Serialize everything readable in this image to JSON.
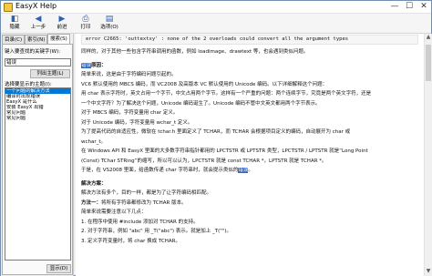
{
  "window": {
    "title": "EasyX Help",
    "minimize": "—",
    "maximize": "☐",
    "close": "✕"
  },
  "toolbar": {
    "buttons": [
      {
        "label": "隐藏",
        "icon": "hide-icon",
        "glyph": "◧"
      },
      {
        "label": "上一步",
        "icon": "back-icon",
        "glyph": "◀"
      },
      {
        "label": "前进",
        "icon": "forward-icon",
        "glyph": "▶"
      },
      {
        "label": "打印",
        "icon": "print-icon",
        "glyph": "⎙"
      },
      {
        "label": "选项(O)",
        "icon": "options-icon",
        "glyph": "▤"
      }
    ]
  },
  "sidebar": {
    "tabs": [
      "目录(C)",
      "索引(N)",
      "搜索(S)"
    ],
    "active_tab": "搜索(S)",
    "keyword_label": "键入要查找的关键字(W):",
    "keyword_value": "错误",
    "list_button": "列出主题(L)",
    "topics_label": "选择要显示的主题(I):",
    "topics": [
      "一个问题的解决方法",
      "编译时出现错误",
      "EasyX 是什么",
      "安装 EasyX 出错",
      "常见问题",
      "常见问题"
    ],
    "selected_topic": 0,
    "show_button": "显示(D)"
  },
  "content": {
    "lines": [
      {
        "cls": "code",
        "text": "error C2665: 'outtextxy' : none of the 2 overloads could convert all the argument types"
      },
      {
        "text": "同样的，对于其他一些包含字符串调用的函数，例如 loadimage、drawtext 等，也会遇到类似问题。"
      },
      {
        "cls": "gap",
        "text": ""
      },
      {
        "hl": "错误",
        "text": "原因："
      },
      {
        "text": "简单来说，这是由于字符编码问题引起的。"
      },
      {
        "text": "VC6 默认使用的 MBCS 编码，而 VC2008 及高版本 VC 默认使用的 Unicode 编码。以下详细解释这个问题："
      },
      {
        "text": "用 char 表示字符时，英文占用一个字节，中文占用两个字节。这样有一个严重的问题：两个连续字节，究竟是两个英文字符，还是"
      },
      {
        "text": "一个中文字符？为了解决这个问题，Unicode 编码诞生了。Unicode 编码不管中文英文都用两个字节表示。"
      },
      {
        "text": "对于 MBCS 编码，字符变量用 char 定义。"
      },
      {
        "text": "对于 Unicode 编码，字符变量用 wchar_t 定义。"
      },
      {
        "text": "为了提高代码的自适应性，微软在 tchar.h 里面定义了 TCHAR，而 TCHAR 会根据项目定义的编码，自动展开为 char 或"
      },
      {
        "text": "wchar_t。"
      },
      {
        "text": "在 Windows API 和 EasyX 里面的大多数字符串指针都用的 LPCTSTR 或 LPTSTR 类型，LPCTSTR / LPTSTR 就是“Long Point"
      },
      {
        "text": "(Const) TChar STRing”的缩写，所以可以认为，LPCTSTR 就是 const TCHAR *，LPTSTR 就是 TCHAR *。"
      },
      {
        "text": "于是，在 VS2008 里面，给函数传递 char 字符串时，就会提示类似的",
        "hl2": "错误",
        "tail": "。"
      },
      {
        "cls": "gap",
        "text": ""
      },
      {
        "cls": "b",
        "text": "解决方案："
      },
      {
        "text": "解决方法有多个，目的一样，都是为了让字符编码相匹配。"
      },
      {
        "text": "方法一：将所有字符串都修改为 TCHAR 版本。",
        "boldlead": "方法一："
      },
      {
        "text": "简单来说需要注意以下几点："
      },
      {
        "text": "1. 在程序中使用 #include 添加对 TCHAR 的支持。"
      },
      {
        "text": "2. 对于字符串，例如 \"abc\" 用 _T(\"abc\") 表示。就是加上 _T(\"\")。"
      },
      {
        "text": "3. 定义字符变量时，将 char 换成 TCHAR。"
      }
    ]
  },
  "colors": {
    "selection": "#0078d7",
    "highlight": "#2f66c4",
    "border": "#6f8fb3"
  }
}
